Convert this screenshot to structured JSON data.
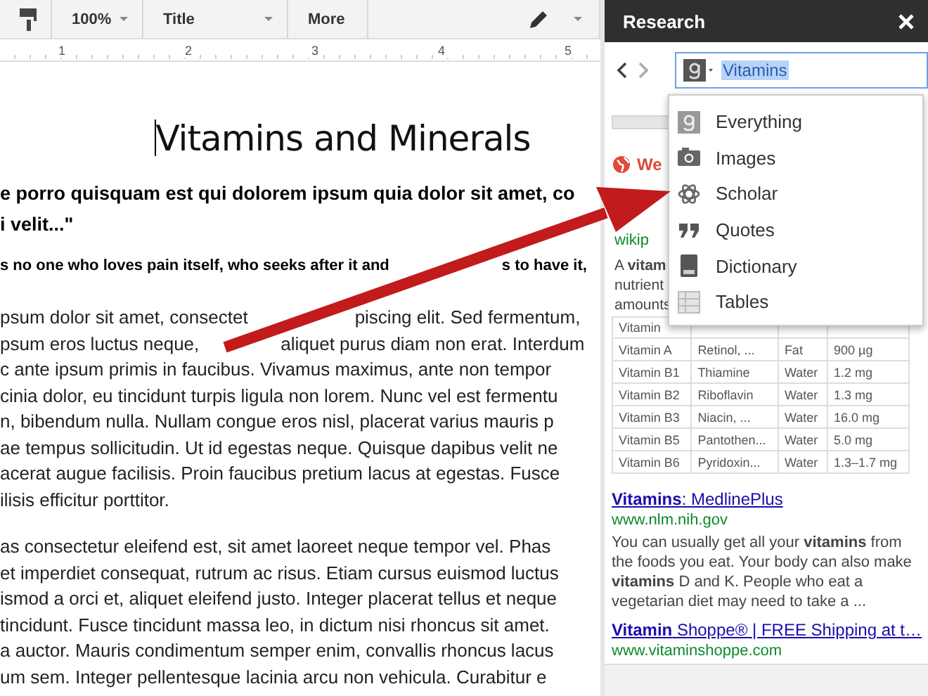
{
  "toolbar": {
    "zoom": "100%",
    "style": "Title",
    "more": "More"
  },
  "ruler": {
    "numbers": [
      "1",
      "2",
      "3",
      "4",
      "5"
    ]
  },
  "document": {
    "title": "Vitamins and Minerals",
    "quote_lines": [
      "e porro quisquam est qui dolorem ipsum quia dolor sit amet, co",
      "i velit...\""
    ],
    "lead_line": [
      "s no one who loves pain itself, who seeks after it and",
      "s to have it,"
    ],
    "paragraphs": [
      [
        [
          "psum dolor sit amet, consectet",
          "piscing elit. Sed fermentum,"
        ],
        [
          "psum eros luctus neque,",
          "aliquet purus diam non erat. Interdum"
        ],
        "c ante ipsum primis in faucibus. Vivamus maximus, ante non tempor",
        "cinia dolor, eu tincidunt turpis ligula non lorem. Nunc vel est fermentu",
        "n, bibendum nulla. Nullam congue eros nisl, placerat varius mauris p",
        "ae tempus sollicitudin. Ut id egestas neque. Quisque dapibus velit ne",
        "acerat augue facilisis. Proin faucibus pretium lacus at egestas. Fusce",
        "ilisis efficitur porttitor."
      ],
      [
        "as consectetur eleifend est, sit amet laoreet neque tempor vel. Phas",
        "et imperdiet consequat, rutrum ac risus. Etiam cursus euismod luctus",
        "ismod a orci et, aliquet eleifend justo. Integer placerat tellus et neque",
        "tincidunt. Fusce tincidunt massa leo, in dictum nisi rhoncus sit amet.",
        "a auctor. Mauris condimentum semper enim, convallis rhoncus lacus",
        "um sem. Integer pellentesque lacinia arcu non vehicula. Curabitur e"
      ]
    ]
  },
  "research": {
    "title": "Research",
    "search": {
      "value": "Vitamins",
      "value_selected": true
    },
    "menu": [
      {
        "label": "Everything",
        "kind": "google"
      },
      {
        "label": "Images",
        "kind": "camera"
      },
      {
        "label": "Scholar",
        "kind": "atom"
      },
      {
        "label": "Quotes",
        "kind": "quote"
      },
      {
        "label": "Dictionary",
        "kind": "book"
      },
      {
        "label": "Tables",
        "kind": "table"
      }
    ],
    "results": {
      "heading": "We",
      "url": "wikip",
      "snippet_lines": [
        "A **vitam**",
        "nutrient",
        "amounts"
      ],
      "table": {
        "header": "Vitamin",
        "rows": [
          [
            "Vitamin A",
            "Retinol, ...",
            "Fat",
            "900 µg"
          ],
          [
            "Vitamin B1",
            "Thiamine",
            "Water",
            "1.2 mg"
          ],
          [
            "Vitamin B2",
            "Riboflavin",
            "Water",
            "1.3 mg"
          ],
          [
            "Vitamin B3",
            "Niacin, ...",
            "Water",
            "16.0 mg"
          ],
          [
            "Vitamin B5",
            "Pantothen...",
            "Water",
            "5.0 mg"
          ],
          [
            "Vitamin B6",
            "Pyridoxin...",
            "Water",
            "1.3–1.7 mg"
          ]
        ]
      },
      "links": [
        {
          "title": "**Vitamins**: MedlinePlus",
          "url": "www.nlm.nih.gov",
          "snippet": "You can usually get all your **vitamins** from the foods you eat. Your body can also make **vitamins** D and K. People who eat a vegetarian diet may need to take a ..."
        },
        {
          "title": "**Vitamin** Shoppe® | FREE Shipping at t…",
          "url": "www.vitaminshoppe.com"
        }
      ]
    }
  }
}
